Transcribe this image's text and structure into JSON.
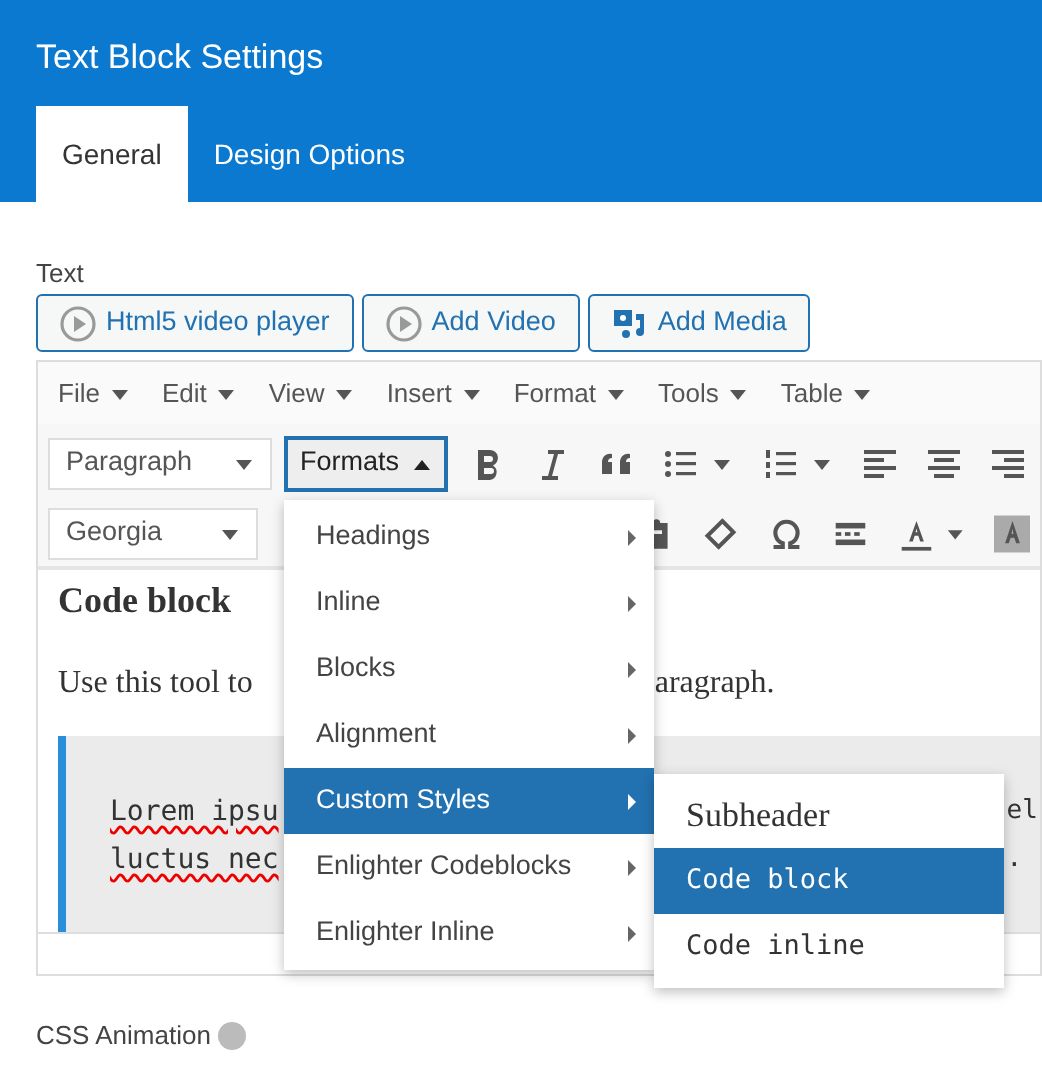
{
  "window": {
    "title": "Text Block Settings"
  },
  "tabs": [
    {
      "label": "General",
      "selected": true
    },
    {
      "label": "Design Options",
      "selected": false
    }
  ],
  "field_label": "Text",
  "media_buttons": [
    {
      "label": "Html5 video player",
      "kind": "play"
    },
    {
      "label": "Add Video",
      "kind": "play"
    },
    {
      "label": "Add Media",
      "kind": "media"
    }
  ],
  "menubar": [
    "File",
    "Edit",
    "View",
    "Insert",
    "Format",
    "Tools",
    "Table"
  ],
  "block_select": {
    "value": "Paragraph"
  },
  "formats_button": {
    "label": "Formats",
    "expanded": true
  },
  "font_select": {
    "value": "Georgia"
  },
  "content": {
    "heading": "Code block",
    "paragraph_left": "Use this tool to",
    "paragraph_right": "aragraph.",
    "code_lines": [
      {
        "left": "Lorem ipsu",
        "right": "el"
      },
      {
        "left": "luctus nec",
        "right": "."
      }
    ]
  },
  "formats_menu": [
    {
      "label": "Headings",
      "selected": false
    },
    {
      "label": "Inline",
      "selected": false
    },
    {
      "label": "Blocks",
      "selected": false
    },
    {
      "label": "Alignment",
      "selected": false
    },
    {
      "label": "Custom Styles",
      "selected": true
    },
    {
      "label": "Enlighter Codeblocks",
      "selected": false
    },
    {
      "label": "Enlighter Inline",
      "selected": false
    }
  ],
  "submenu": [
    {
      "label": "Subheader",
      "kind": "serif",
      "selected": false
    },
    {
      "label": "Code block",
      "kind": "code",
      "selected": true
    },
    {
      "label": "Code inline",
      "kind": "code",
      "selected": false
    }
  ],
  "next_field_label": "CSS Animation"
}
